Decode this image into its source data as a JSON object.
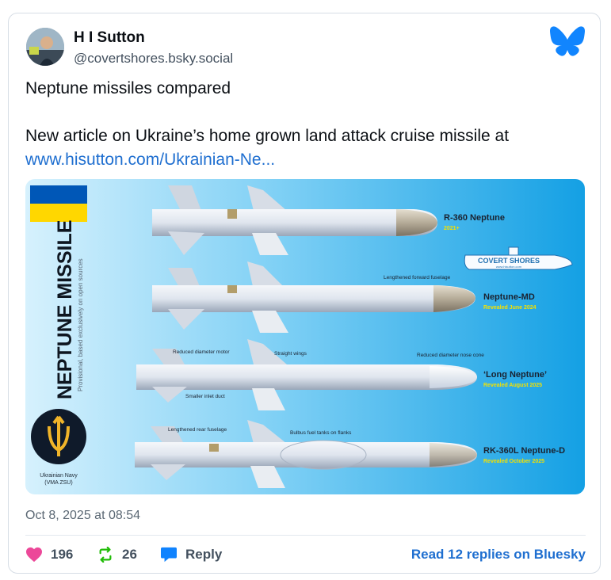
{
  "post": {
    "author_name": "H I Sutton",
    "author_handle": "@covertshores.bsky.social",
    "text_line1": "Neptune missiles compared",
    "text_line2": "New article on Ukraine’s home grown land attack cruise missile at",
    "link_text": "www.hisutton.com/Ukrainian-Ne...",
    "timestamp": "Oct 8, 2025 at 08:54"
  },
  "actions": {
    "likes": "196",
    "reposts": "26",
    "reply_label": "Reply",
    "read_replies_label": "Read 12 replies on Bluesky"
  },
  "infographic": {
    "side_title": "NEPTUNE MISSILE",
    "side_subtitle": "Provisional, based exclusively on open sources",
    "navy_label_line1": "Ukrainian Navy",
    "navy_label_line2": "(VMA ZSU)",
    "brand": "COVERT SHORES",
    "brand_url": "www.hisutton.com",
    "missiles": [
      {
        "name": "R-360 Neptune",
        "note": "2021+"
      },
      {
        "name": "Neptune-MD",
        "note": "Revealed June 2024"
      },
      {
        "name": "‘Long Neptune’",
        "note": "Revealed August 2025"
      },
      {
        "name": "RK-360L Neptune-D",
        "note": "Revealed October 2025"
      }
    ],
    "annotations": {
      "lengthened_forward": "Lengthened forward fuselage",
      "reduced_motor": "Reduced diameter motor",
      "straight_wings": "Straight wings",
      "reduced_nose": "Reduced diameter nose cone",
      "smaller_inlet": "Smaller inlet duct",
      "lengthened_rear": "Lengthened rear fuselage",
      "bulbus_tanks": "Bulbus fuel tanks on flanks"
    },
    "colors": {
      "background_light": "#cfeefd",
      "background_dark": "#1aa3e6",
      "label_yellow": "#f4e100",
      "flag_blue": "#0057b7",
      "flag_yellow": "#ffd700"
    }
  },
  "colors": {
    "like": "#ec4899",
    "repost": "#20bc07",
    "reply": "#1083fe",
    "link": "#1f6fd0",
    "bluesky_logo": "#1185fe"
  }
}
